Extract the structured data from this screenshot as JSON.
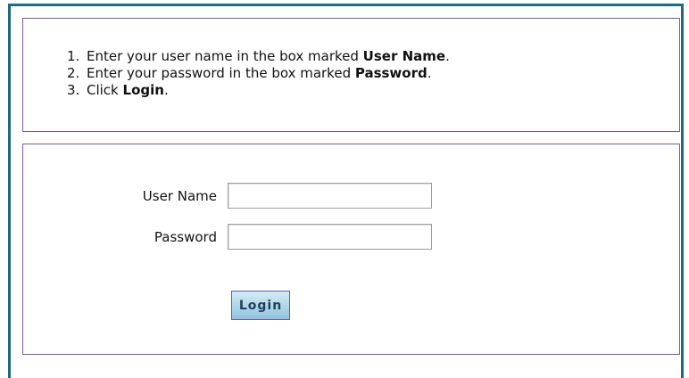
{
  "instructions": {
    "items": [
      {
        "number": "1.",
        "before": "Enter your user name in the box marked ",
        "bold": "User Name",
        "after": "."
      },
      {
        "number": "2.",
        "before": "Enter your password in the box marked ",
        "bold": "Password",
        "after": "."
      },
      {
        "number": "3.",
        "before": "Click ",
        "bold": "Login",
        "after": "."
      }
    ]
  },
  "form": {
    "username_label": "User Name",
    "username_value": "",
    "password_label": "Password",
    "password_value": "",
    "login_label": "Login"
  },
  "colors": {
    "frame_border": "#1e6a80",
    "box_border": "#7a5aa6",
    "button_gradient_top": "#d6ebf5",
    "button_gradient_bottom": "#8fc3dd"
  }
}
